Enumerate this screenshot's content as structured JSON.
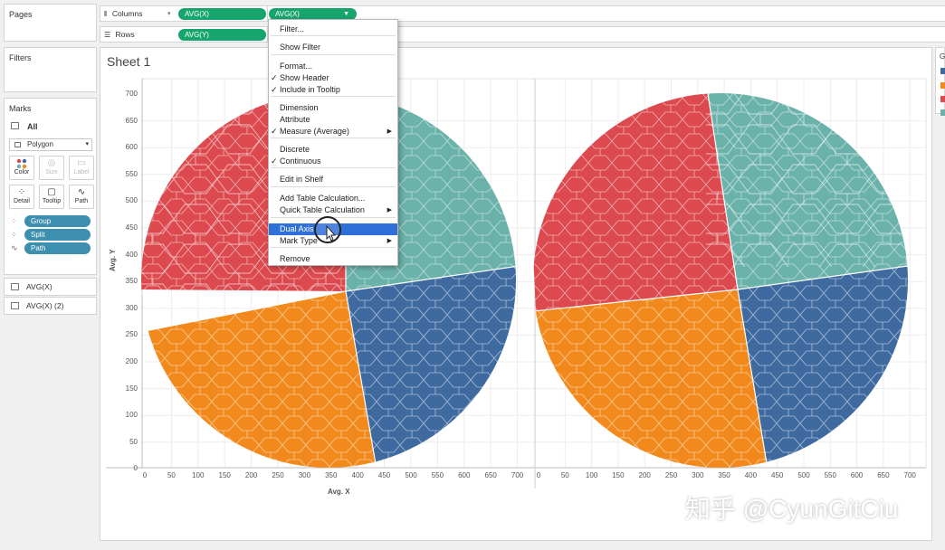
{
  "shelves": {
    "columns_label": "Columns",
    "rows_label": "Rows",
    "columns_pills": [
      "AVG(X)",
      "AVG(X)"
    ],
    "rows_pills": [
      "AVG(Y)"
    ]
  },
  "left": {
    "pages_title": "Pages",
    "filters_title": "Filters",
    "marks_title": "Marks",
    "marks_all": "All",
    "mark_type": "Polygon",
    "buttons": [
      "Color",
      "Size",
      "Label",
      "Detail",
      "Tooltip",
      "Path"
    ],
    "mark_pills": [
      "Group",
      "Split",
      "Path"
    ],
    "layers": [
      "AVG(X)",
      "AVG(X) (2)"
    ]
  },
  "sheet": {
    "title": "Sheet 1",
    "y_axis_label": "Avg. Y",
    "x_axis_label": "Avg. X",
    "y_ticks": [
      "700",
      "650",
      "600",
      "550",
      "500",
      "450",
      "400",
      "350",
      "300",
      "250",
      "200",
      "150",
      "100",
      "50",
      "0"
    ],
    "x_ticks": [
      "0",
      "50",
      "100",
      "150",
      "200",
      "250",
      "300",
      "350",
      "400",
      "450",
      "500",
      "550",
      "600",
      "650",
      "700"
    ]
  },
  "legend": {
    "title_partial": "G",
    "colors": [
      "#3e6aa0",
      "#f2891c",
      "#dc4a4f",
      "#6bb2aa"
    ]
  },
  "context_menu": {
    "items": [
      {
        "label": "Filter...",
        "checked": false,
        "submenu": false
      },
      {
        "label": "Show Filter",
        "checked": false,
        "submenu": false
      },
      {
        "label": "Format...",
        "checked": false,
        "submenu": false
      },
      {
        "label": "Show Header",
        "checked": true,
        "submenu": false
      },
      {
        "label": "Include in Tooltip",
        "checked": true,
        "submenu": false
      },
      {
        "label": "Dimension",
        "checked": false,
        "submenu": false
      },
      {
        "label": "Attribute",
        "checked": false,
        "submenu": false
      },
      {
        "label": "Measure (Average)",
        "checked": true,
        "submenu": true
      },
      {
        "label": "Discrete",
        "checked": false,
        "submenu": false
      },
      {
        "label": "Continuous",
        "checked": true,
        "submenu": false
      },
      {
        "label": "Edit in Shelf",
        "checked": false,
        "submenu": false
      },
      {
        "label": "Add Table Calculation...",
        "checked": false,
        "submenu": false
      },
      {
        "label": "Quick Table Calculation",
        "checked": false,
        "submenu": true
      },
      {
        "label": "Dual Axis",
        "checked": false,
        "submenu": false,
        "highlighted": true
      },
      {
        "label": "Mark Type",
        "checked": false,
        "submenu": true
      },
      {
        "label": "Remove",
        "checked": false,
        "submenu": false
      }
    ]
  },
  "watermark": "知乎 @CyunGitCiu"
}
